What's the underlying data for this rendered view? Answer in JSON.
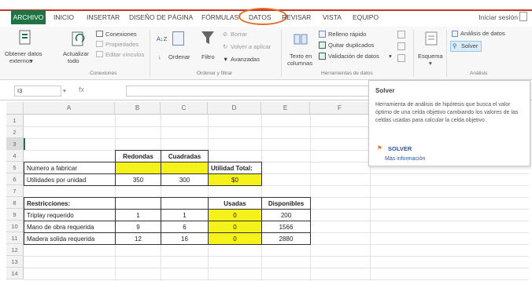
{
  "menu": {
    "file": "ARCHIVO",
    "tabs": [
      "INICIO",
      "INSERTAR",
      "DISEÑO DE PÁGINA",
      "FÓRMULAS",
      "DATOS",
      "REVISAR",
      "VISTA",
      "EQUIPO"
    ],
    "active_tab": "DATOS",
    "signin": "Iniciar sesión"
  },
  "ribbon": {
    "external": "Obtener datos externos",
    "external_l1": "Obtener datos",
    "external_l2": "externos",
    "refresh_l1": "Actualizar",
    "refresh_l2": "todo",
    "connections": "Conexiones",
    "properties": "Propiedades",
    "edit_links": "Editar vínculos",
    "group_connections": "Conexiones",
    "sort_az": "A↓Z",
    "sort": "Ordenar",
    "filter": "Filtro",
    "clear": "Borrar",
    "reapply": "Volver a aplicar",
    "advanced": "Avanzadas",
    "group_sort": "Ordenar y filtrar",
    "text_cols_l1": "Texto en",
    "text_cols_l2": "columnas",
    "flash_fill": "Relleno rápido",
    "remove_dup": "Quitar duplicados",
    "validation": "Validación de datos",
    "group_tools": "Herramientas de datos",
    "outline": "Esquema",
    "analysis": "Análisis de datos",
    "solver": "Solver",
    "group_analysis": "Análisis"
  },
  "formula_bar": {
    "name_box": "I3",
    "fx": "fx"
  },
  "columns": [
    "A",
    "B",
    "C",
    "D",
    "E",
    "F"
  ],
  "rows": [
    "1",
    "2",
    "3",
    "4",
    "5",
    "6",
    "7",
    "8",
    "9",
    "10",
    "11",
    "12",
    "13",
    "14"
  ],
  "sheet": {
    "h_redondas": "Redondas",
    "h_cuadradas": "Cuadradas",
    "a5": "Numero a fabricar",
    "d5": "Utilidad Total:",
    "a6": "Utilidades por unidad",
    "b6": "350",
    "c6": "300",
    "d6": "$0",
    "a8": "Restricciones:",
    "d8": "Usadas",
    "e8": "Disponibles",
    "a9": "Triplay requerido",
    "b9": "1",
    "c9": "1",
    "d9": "0",
    "e9": "200",
    "a10": "Mano de obra requerida",
    "b10": "9",
    "c10": "6",
    "d10": "0",
    "e10": "1566",
    "a11": "Madera solida requerida",
    "b11": "12",
    "c11": "16",
    "d11": "0",
    "e11": "2880"
  },
  "tooltip": {
    "title": "Solver",
    "description": "Herramienta de análisis de hipótesis que busca el valor óptimo de una celda objetivo cambiando los valores de las celdas usadas para calcular la celda objetivo.",
    "solver_label": "SOLVER",
    "more_info": "Más información"
  },
  "colors": {
    "excel_green": "#217346",
    "highlight_yellow": "#f5f11a",
    "ring_orange": "#e66a1f",
    "menu_red": "#c0392b"
  }
}
